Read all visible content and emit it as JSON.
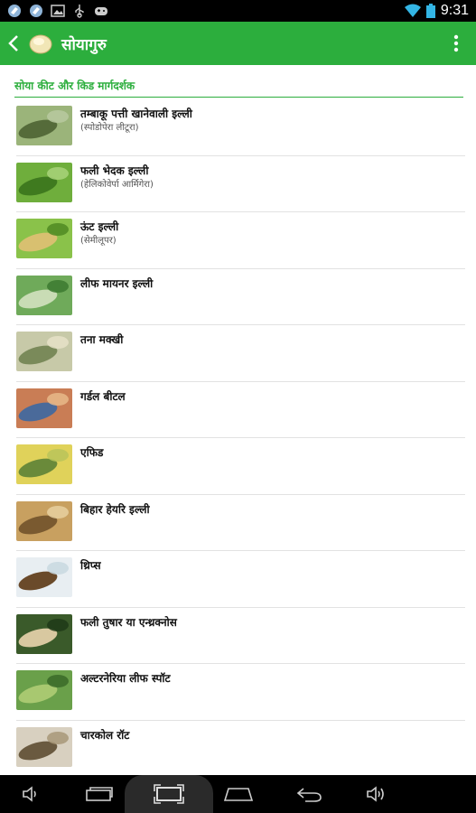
{
  "status_bar": {
    "time": "9:31",
    "left_icons": [
      "browser-icon",
      "browser-icon",
      "image-icon",
      "usb-icon",
      "gamepad-icon"
    ],
    "right_icons": [
      "wifi-icon",
      "battery-icon"
    ]
  },
  "app_bar": {
    "title": "सोयागुरु",
    "back_icon": "back-arrow-icon",
    "logo_icon": "soybean-logo-icon",
    "menu_icon": "overflow-menu-icon"
  },
  "section": {
    "header": "सोया कीट और किड मार्गदर्शक"
  },
  "items": [
    {
      "title": "तम्बाकू पत्ती खानेवाली इल्ली",
      "subtitle": "(स्पोडोपेरा लीटूरा)",
      "thumb_colors": [
        "#9bb47a",
        "#556b3a",
        "#b9c9a0"
      ]
    },
    {
      "title": "फली भेदक इल्ली",
      "subtitle": "(हेलिकोवेर्पा आर्मिगेरा)",
      "thumb_colors": [
        "#6fae3c",
        "#3f7a1f",
        "#a9d47a"
      ]
    },
    {
      "title": "ऊंट इल्ली",
      "subtitle": "(सेमीलूपर)",
      "thumb_colors": [
        "#8ac24a",
        "#d8c070",
        "#4f8a22"
      ]
    },
    {
      "title": "लीफ मायनर  इल्ली",
      "subtitle": "",
      "thumb_colors": [
        "#6faa5a",
        "#c9dcb5",
        "#3c7a30"
      ]
    },
    {
      "title": "तना मक्खी",
      "subtitle": "",
      "thumb_colors": [
        "#c7c9a8",
        "#7a8a5a",
        "#e6e2c8"
      ]
    },
    {
      "title": "गर्डल बीटल",
      "subtitle": "",
      "thumb_colors": [
        "#c97d55",
        "#4a6a9a",
        "#e8b88a"
      ]
    },
    {
      "title": "एफिड",
      "subtitle": "",
      "thumb_colors": [
        "#e0d25a",
        "#6a8a3a",
        "#b9c45a"
      ]
    },
    {
      "title": "बिहार हेयरि इल्ली",
      "subtitle": "",
      "thumb_colors": [
        "#c8a060",
        "#7a5a30",
        "#e8d0a0"
      ]
    },
    {
      "title": "थ्रिप्स",
      "subtitle": "",
      "thumb_colors": [
        "#e8eef2",
        "#6a4a2a",
        "#c8d8e0"
      ]
    },
    {
      "title": "फली तुषार या एन्थ्रक्नोस",
      "subtitle": "",
      "thumb_colors": [
        "#3a5a2a",
        "#d8c8a0",
        "#1e3a18"
      ]
    },
    {
      "title": "अल्टरनेरिया लीफ स्पॉट",
      "subtitle": "",
      "thumb_colors": [
        "#6aa04a",
        "#a8c870",
        "#3a6a28"
      ]
    },
    {
      "title": "चारकोल रॉट",
      "subtitle": "",
      "thumb_colors": [
        "#d8d0c0",
        "#6a5a40",
        "#a89878"
      ]
    }
  ],
  "nav_bar": {
    "icons": [
      "volume-down-icon",
      "back-nav-icon",
      "recent-apps-icon",
      "home-icon",
      "back-nav-icon",
      "volume-up-icon"
    ]
  }
}
